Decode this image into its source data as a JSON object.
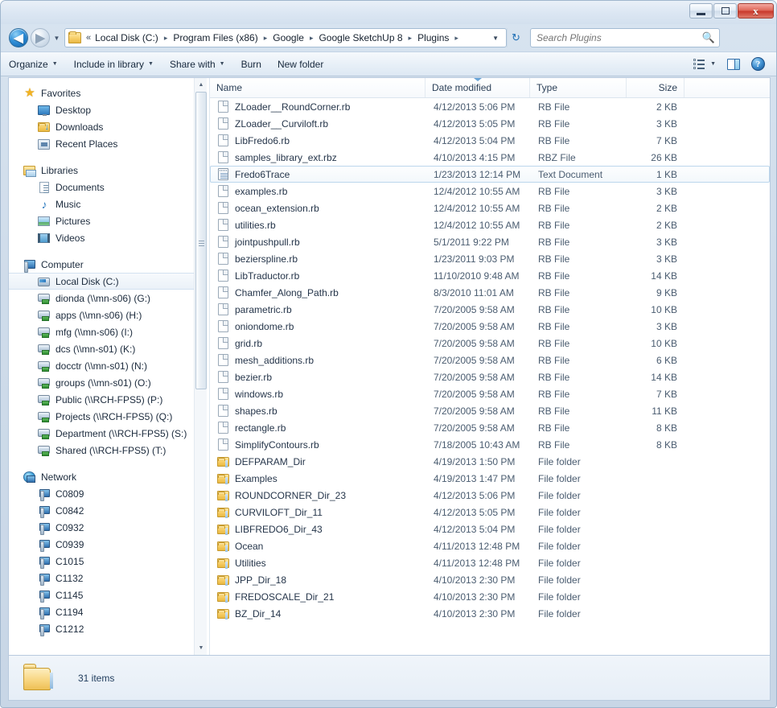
{
  "window": {
    "minimize_label": "",
    "maximize_label": "",
    "close_label": "x"
  },
  "address": {
    "back_glyph": "◀",
    "forward_glyph": "▶",
    "recent_glyph": "▼",
    "leading_chevrons": "«",
    "crumbs": [
      "Local Disk (C:)",
      "Program Files (x86)",
      "Google",
      "Google SketchUp 8",
      "Plugins"
    ],
    "separator": "▸",
    "dropdown_glyph": "▼",
    "refresh_glyph": "↻"
  },
  "search": {
    "placeholder": "Search Plugins",
    "value": "",
    "icon": "search-icon"
  },
  "toolbar": {
    "items": [
      {
        "label": "Organize",
        "has_caret": true
      },
      {
        "label": "Include in library",
        "has_caret": true
      },
      {
        "label": "Share with",
        "has_caret": true
      },
      {
        "label": "Burn",
        "has_caret": false
      },
      {
        "label": "New folder",
        "has_caret": false
      }
    ],
    "view_caret": "▼",
    "help_label": "?"
  },
  "sidebar": {
    "groups": [
      {
        "name": "Favorites",
        "icon": "star-icon",
        "items": [
          {
            "label": "Desktop",
            "icon": "desktop-monitor-icon"
          },
          {
            "label": "Downloads",
            "icon": "downloads-folder-icon"
          },
          {
            "label": "Recent Places",
            "icon": "recent-places-icon"
          }
        ]
      },
      {
        "name": "Libraries",
        "icon": "libraries-icon",
        "items": [
          {
            "label": "Documents",
            "icon": "document-icon"
          },
          {
            "label": "Music",
            "icon": "music-note-icon"
          },
          {
            "label": "Pictures",
            "icon": "picture-icon"
          },
          {
            "label": "Videos",
            "icon": "video-icon"
          }
        ]
      },
      {
        "name": "Computer",
        "icon": "computer-icon",
        "items": [
          {
            "label": "Local Disk (C:)",
            "icon": "hard-drive-icon",
            "selected": true
          },
          {
            "label": "dionda (\\\\mn-s06) (G:)",
            "icon": "network-drive-icon"
          },
          {
            "label": "apps (\\\\mn-s06) (H:)",
            "icon": "network-drive-icon"
          },
          {
            "label": "mfg (\\\\mn-s06) (I:)",
            "icon": "network-drive-icon"
          },
          {
            "label": "dcs (\\\\mn-s01) (K:)",
            "icon": "network-drive-icon"
          },
          {
            "label": "docctr (\\\\mn-s01) (N:)",
            "icon": "network-drive-icon"
          },
          {
            "label": "groups (\\\\mn-s01) (O:)",
            "icon": "network-drive-icon"
          },
          {
            "label": "Public (\\\\RCH-FPS5) (P:)",
            "icon": "network-drive-icon"
          },
          {
            "label": "Projects (\\\\RCH-FPS5) (Q:)",
            "icon": "network-drive-icon"
          },
          {
            "label": "Department (\\\\RCH-FPS5) (S:)",
            "icon": "network-drive-icon"
          },
          {
            "label": "Shared (\\\\RCH-FPS5) (T:)",
            "icon": "network-drive-icon"
          }
        ]
      },
      {
        "name": "Network",
        "icon": "network-globe-icon",
        "items": [
          {
            "label": "C0809",
            "icon": "computer-node-icon"
          },
          {
            "label": "C0842",
            "icon": "computer-node-icon"
          },
          {
            "label": "C0932",
            "icon": "computer-node-icon"
          },
          {
            "label": "C0939",
            "icon": "computer-node-icon"
          },
          {
            "label": "C1015",
            "icon": "computer-node-icon"
          },
          {
            "label": "C1132",
            "icon": "computer-node-icon"
          },
          {
            "label": "C1145",
            "icon": "computer-node-icon"
          },
          {
            "label": "C1194",
            "icon": "computer-node-icon"
          },
          {
            "label": "C1212",
            "icon": "computer-node-icon"
          }
        ]
      }
    ]
  },
  "filelist": {
    "columns": [
      {
        "label": "Name",
        "sorted": false
      },
      {
        "label": "Date modified",
        "sorted": true
      },
      {
        "label": "Type",
        "sorted": false
      },
      {
        "label": "Size",
        "sorted": false
      }
    ],
    "rows": [
      {
        "name": "ZLoader__RoundCorner.rb",
        "date": "4/12/2013 5:06 PM",
        "type": "RB File",
        "size": "2 KB",
        "icon": "file-icon"
      },
      {
        "name": "ZLoader__Curviloft.rb",
        "date": "4/12/2013 5:05 PM",
        "type": "RB File",
        "size": "3 KB",
        "icon": "file-icon"
      },
      {
        "name": "LibFredo6.rb",
        "date": "4/12/2013 5:04 PM",
        "type": "RB File",
        "size": "7 KB",
        "icon": "file-icon"
      },
      {
        "name": "samples_library_ext.rbz",
        "date": "4/10/2013 4:15 PM",
        "type": "RBZ File",
        "size": "26 KB",
        "icon": "file-icon"
      },
      {
        "name": "Fredo6Trace",
        "date": "1/23/2013 12:14 PM",
        "type": "Text Document",
        "size": "1 KB",
        "icon": "text-document-icon",
        "selected": true
      },
      {
        "name": "examples.rb",
        "date": "12/4/2012 10:55 AM",
        "type": "RB File",
        "size": "3 KB",
        "icon": "file-icon"
      },
      {
        "name": "ocean_extension.rb",
        "date": "12/4/2012 10:55 AM",
        "type": "RB File",
        "size": "2 KB",
        "icon": "file-icon"
      },
      {
        "name": "utilities.rb",
        "date": "12/4/2012 10:55 AM",
        "type": "RB File",
        "size": "2 KB",
        "icon": "file-icon"
      },
      {
        "name": "jointpushpull.rb",
        "date": "5/1/2011 9:22 PM",
        "type": "RB File",
        "size": "3 KB",
        "icon": "file-icon"
      },
      {
        "name": "bezierspline.rb",
        "date": "1/23/2011 9:03 PM",
        "type": "RB File",
        "size": "3 KB",
        "icon": "file-icon"
      },
      {
        "name": "LibTraductor.rb",
        "date": "11/10/2010 9:48 AM",
        "type": "RB File",
        "size": "14 KB",
        "icon": "file-icon"
      },
      {
        "name": "Chamfer_Along_Path.rb",
        "date": "8/3/2010 11:01 AM",
        "type": "RB File",
        "size": "9 KB",
        "icon": "file-icon"
      },
      {
        "name": "parametric.rb",
        "date": "7/20/2005 9:58 AM",
        "type": "RB File",
        "size": "10 KB",
        "icon": "file-icon"
      },
      {
        "name": "oniondome.rb",
        "date": "7/20/2005 9:58 AM",
        "type": "RB File",
        "size": "3 KB",
        "icon": "file-icon"
      },
      {
        "name": "grid.rb",
        "date": "7/20/2005 9:58 AM",
        "type": "RB File",
        "size": "10 KB",
        "icon": "file-icon"
      },
      {
        "name": "mesh_additions.rb",
        "date": "7/20/2005 9:58 AM",
        "type": "RB File",
        "size": "6 KB",
        "icon": "file-icon"
      },
      {
        "name": "bezier.rb",
        "date": "7/20/2005 9:58 AM",
        "type": "RB File",
        "size": "14 KB",
        "icon": "file-icon"
      },
      {
        "name": "windows.rb",
        "date": "7/20/2005 9:58 AM",
        "type": "RB File",
        "size": "7 KB",
        "icon": "file-icon"
      },
      {
        "name": "shapes.rb",
        "date": "7/20/2005 9:58 AM",
        "type": "RB File",
        "size": "11 KB",
        "icon": "file-icon"
      },
      {
        "name": "rectangle.rb",
        "date": "7/20/2005 9:58 AM",
        "type": "RB File",
        "size": "8 KB",
        "icon": "file-icon"
      },
      {
        "name": "SimplifyContours.rb",
        "date": "7/18/2005 10:43 AM",
        "type": "RB File",
        "size": "8 KB",
        "icon": "file-icon"
      },
      {
        "name": "DEFPARAM_Dir",
        "date": "4/19/2013 1:50 PM",
        "type": "File folder",
        "size": "",
        "icon": "folder-icon"
      },
      {
        "name": "Examples",
        "date": "4/19/2013 1:47 PM",
        "type": "File folder",
        "size": "",
        "icon": "folder-icon"
      },
      {
        "name": "ROUNDCORNER_Dir_23",
        "date": "4/12/2013 5:06 PM",
        "type": "File folder",
        "size": "",
        "icon": "folder-icon"
      },
      {
        "name": "CURVILOFT_Dir_11",
        "date": "4/12/2013 5:05 PM",
        "type": "File folder",
        "size": "",
        "icon": "folder-icon"
      },
      {
        "name": "LIBFREDO6_Dir_43",
        "date": "4/12/2013 5:04 PM",
        "type": "File folder",
        "size": "",
        "icon": "folder-icon"
      },
      {
        "name": "Ocean",
        "date": "4/11/2013 12:48 PM",
        "type": "File folder",
        "size": "",
        "icon": "folder-icon"
      },
      {
        "name": "Utilities",
        "date": "4/11/2013 12:48 PM",
        "type": "File folder",
        "size": "",
        "icon": "folder-icon"
      },
      {
        "name": "JPP_Dir_18",
        "date": "4/10/2013 2:30 PM",
        "type": "File folder",
        "size": "",
        "icon": "folder-icon"
      },
      {
        "name": "FREDOSCALE_Dir_21",
        "date": "4/10/2013 2:30 PM",
        "type": "File folder",
        "size": "",
        "icon": "folder-icon"
      },
      {
        "name": "BZ_Dir_14",
        "date": "4/10/2013 2:30 PM",
        "type": "File folder",
        "size": "",
        "icon": "folder-icon"
      }
    ]
  },
  "statusbar": {
    "item_count": "31 items",
    "folder_icon": "folder-icon"
  },
  "scrollbar": {
    "up_glyph": "▲",
    "down_glyph": "▼"
  }
}
